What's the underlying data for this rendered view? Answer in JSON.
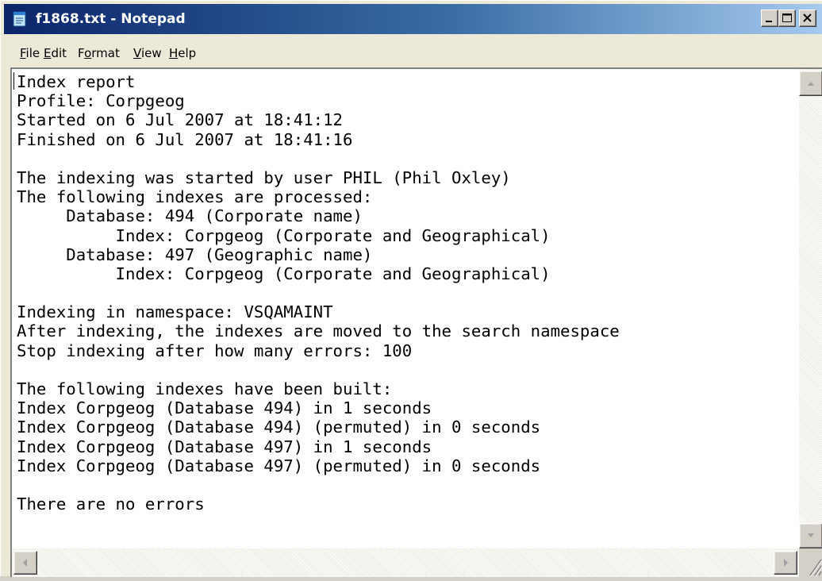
{
  "window": {
    "title": "f1868.txt - Notepad"
  },
  "menu": {
    "file": {
      "mnemonic": "F",
      "rest": "ile"
    },
    "edit": {
      "mnemonic": "E",
      "rest": "dit"
    },
    "format": {
      "pre": "F",
      "mnemonic": "o",
      "rest": "rmat"
    },
    "view": {
      "mnemonic": "V",
      "rest": "iew"
    },
    "help": {
      "mnemonic": "H",
      "rest": "elp"
    }
  },
  "document": {
    "lines": [
      "Index report",
      "Profile: Corpgeog",
      "Started on 6 Jul 2007 at 18:41:12",
      "Finished on 6 Jul 2007 at 18:41:16",
      "",
      "The indexing was started by user PHIL (Phil Oxley)",
      "The following indexes are processed:",
      "     Database: 494 (Corporate name)",
      "          Index: Corpgeog (Corporate and Geographical)",
      "     Database: 497 (Geographic name)",
      "          Index: Corpgeog (Corporate and Geographical)",
      "",
      "Indexing in namespace: VSQAMAINT",
      "After indexing, the indexes are moved to the search namespace",
      "Stop indexing after how many errors: 100",
      "",
      "The following indexes have been built:",
      "Index Corpgeog (Database 494) in 1 seconds",
      "Index Corpgeog (Database 494) (permuted) in 0 seconds",
      "Index Corpgeog (Database 497) in 1 seconds",
      "Index Corpgeog (Database 497) (permuted) in 0 seconds",
      "",
      "There are no errors"
    ]
  },
  "icons": {
    "app": "notepad-icon",
    "minimize": "minimize-icon",
    "maximize": "maximize-icon",
    "close": "close-icon",
    "scroll_up": "arrow-up-icon",
    "scroll_down": "arrow-down-icon",
    "scroll_left": "arrow-left-icon",
    "scroll_right": "arrow-right-icon",
    "size_grip": "size-grip-icon"
  },
  "colors": {
    "titlebar_start": "#0a246a",
    "titlebar_end": "#a6caf0",
    "chrome": "#d4d0c8",
    "text": "#000000"
  }
}
